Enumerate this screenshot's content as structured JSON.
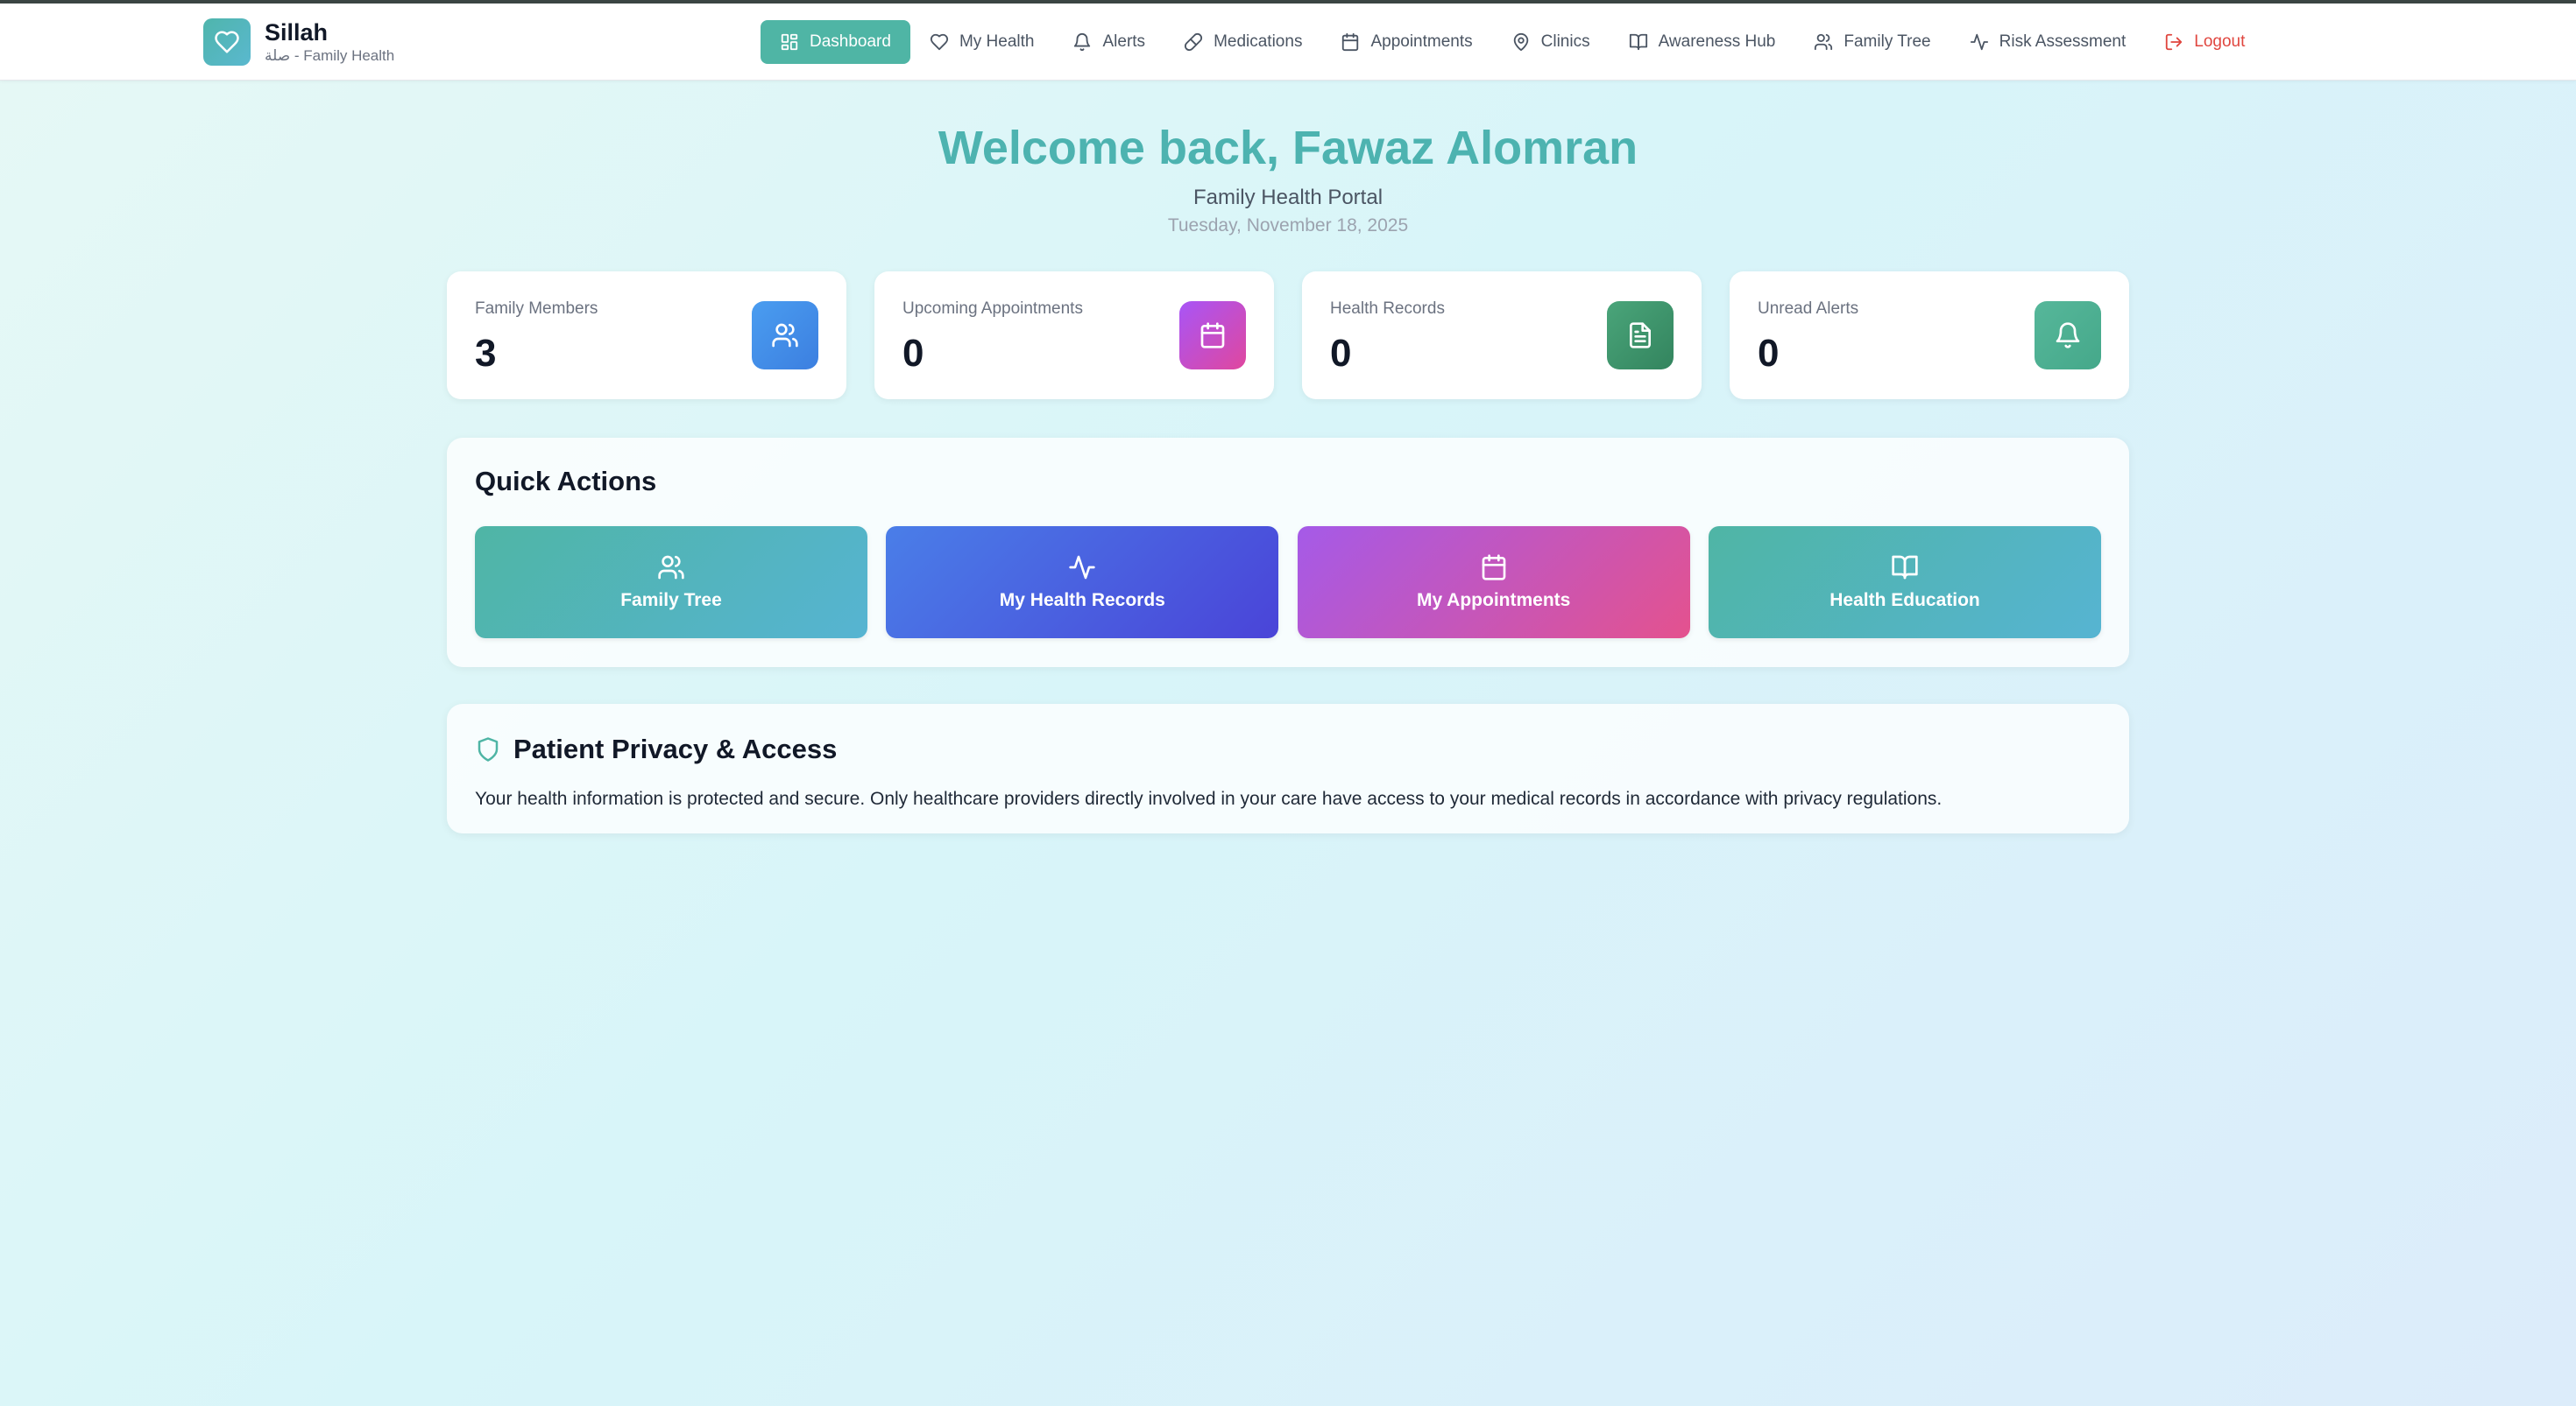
{
  "brand": {
    "name": "Sillah",
    "subtitle": "صلة - Family Health",
    "logo_icon": "heart-icon"
  },
  "nav": [
    {
      "label": "Dashboard",
      "icon": "dashboard-icon",
      "active": true
    },
    {
      "label": "My Health",
      "icon": "heart-icon"
    },
    {
      "label": "Alerts",
      "icon": "bell-icon"
    },
    {
      "label": "Medications",
      "icon": "pill-icon"
    },
    {
      "label": "Appointments",
      "icon": "calendar-icon"
    },
    {
      "label": "Clinics",
      "icon": "map-pin-icon"
    },
    {
      "label": "Awareness Hub",
      "icon": "book-icon"
    },
    {
      "label": "Family Tree",
      "icon": "users-icon"
    },
    {
      "label": "Risk Assessment",
      "icon": "activity-icon"
    },
    {
      "label": "Logout",
      "icon": "logout-icon"
    }
  ],
  "welcome": {
    "title": "Welcome back, Fawaz Alomran",
    "subtitle": "Family Health Portal",
    "date": "Tuesday, November 18, 2025"
  },
  "stats": [
    {
      "label": "Family Members",
      "value": "3",
      "icon": "users-icon",
      "color": "#3f8de6"
    },
    {
      "label": "Upcoming Appointments",
      "value": "0",
      "icon": "calendar-icon",
      "color": "#c94bc6"
    },
    {
      "label": "Health Records",
      "value": "0",
      "icon": "file-icon",
      "color": "#3f9a6f"
    },
    {
      "label": "Unread Alerts",
      "value": "0",
      "icon": "bell-icon",
      "color": "#4fb193"
    }
  ],
  "quick_actions": {
    "title": "Quick Actions",
    "buttons": [
      {
        "label": "Family Tree",
        "icon": "users-icon"
      },
      {
        "label": "My Health Records",
        "icon": "activity-icon"
      },
      {
        "label": "My Appointments",
        "icon": "calendar-icon"
      },
      {
        "label": "Health Education",
        "icon": "book-icon"
      }
    ]
  },
  "privacy": {
    "title": "Patient Privacy & Access",
    "icon": "shield-icon",
    "text": "Your health information is protected and secure. Only healthcare providers directly involved in your care have access to your medical records in accordance with privacy regulations."
  },
  "colors": {
    "accent": "#4fb5a5",
    "welcome_title": "#4db3b0",
    "logout": "#e0463f"
  }
}
